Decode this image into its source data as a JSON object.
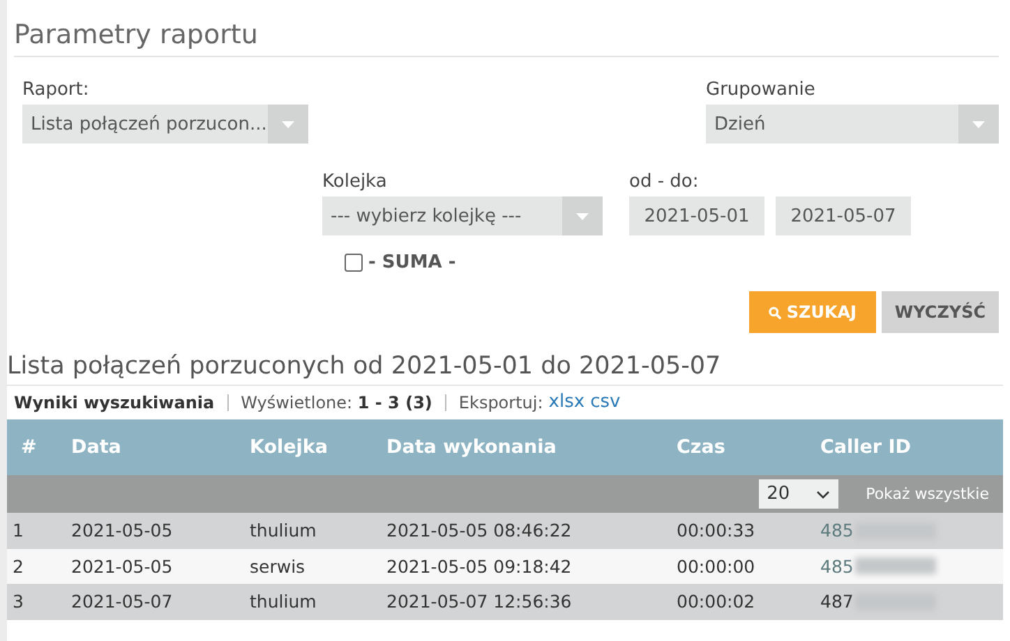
{
  "params": {
    "title": "Parametry raportu",
    "report": {
      "label": "Raport:",
      "value": "Lista połączeń porzucon..."
    },
    "grouping": {
      "label": "Grupowanie",
      "value": "Dzień"
    },
    "queue": {
      "label": "Kolejka",
      "value": "--- wybierz kolejkę ---"
    },
    "range": {
      "label": "od - do:",
      "from": "2021-05-01",
      "to": "2021-05-07"
    },
    "sum": {
      "label": "- SUMA -",
      "checked": false
    },
    "buttons": [
      {
        "kind": "primary",
        "label": "SZUKAJ"
      },
      {
        "kind": "secondary",
        "label": "WYCZYŚĆ"
      }
    ]
  },
  "results": {
    "title": "Lista połączeń porzuconych od 2021-05-01 do 2021-05-07",
    "summary": "**Wyniki wyszukiwania**",
    "shown": "Wyświetlone: **1 - 3 (3)**",
    "export_label": "Eksportuj:",
    "export_links": [
      "xlsx",
      "csv"
    ],
    "table": {
      "columns": [
        "#",
        "Data",
        "Kolejka",
        "Data wykonania",
        "Czas",
        "Caller ID"
      ],
      "page_size": "20",
      "show_all": "Pokaż wszystkie",
      "rows": [
        {
          "cells": [
            "1",
            "2021-05-05",
            "thulium",
            "2021-05-05 08:46:22",
            "00:00:33",
            "485"
          ],
          "linked": true
        },
        {
          "cells": [
            "2",
            "2021-05-05",
            "serwis",
            "2021-05-05 09:18:42",
            "00:00:00",
            "485"
          ],
          "linked": true
        },
        {
          "cells": [
            "3",
            "2021-05-07",
            "thulium",
            "2021-05-07 12:56:36",
            "00:00:02",
            "487"
          ],
          "linked": false
        }
      ]
    }
  }
}
